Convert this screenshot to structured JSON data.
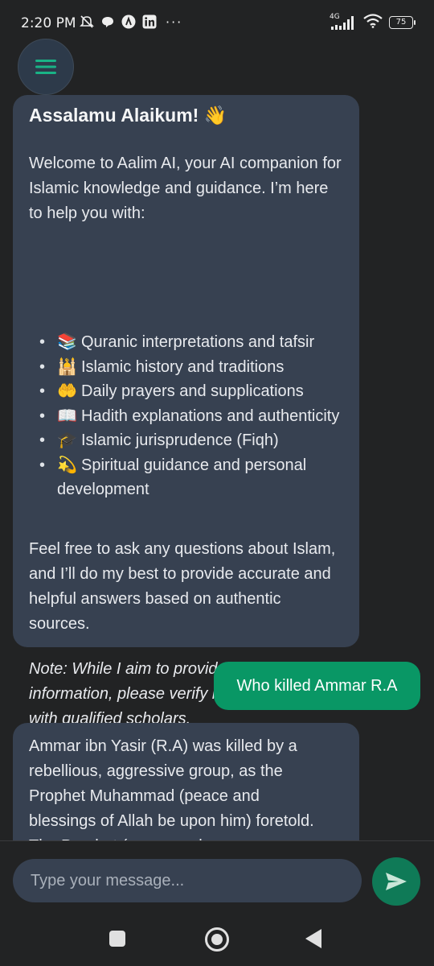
{
  "status_bar": {
    "time": "2:20 PM",
    "network": "4G",
    "battery": "75",
    "more": "···",
    "icons": [
      "mute-icon",
      "chat-bubble-icon",
      "app-a-icon",
      "linkedin-icon",
      "signal-icon",
      "wifi-icon",
      "battery-icon"
    ]
  },
  "menu": {
    "icon": "hamburger-menu-icon"
  },
  "welcome": {
    "title": "Assalamu Alaikum! 👋",
    "intro": "Welcome to Aalim AI, your AI companion for Islamic knowledge and guidance. I’m here to help you with:",
    "items": [
      {
        "emoji": "📚",
        "text": "Quranic interpretations and tafsir"
      },
      {
        "emoji": "🕌",
        "text": "Islamic history and traditions"
      },
      {
        "emoji": "🤲",
        "text": "Daily prayers and supplications"
      },
      {
        "emoji": "📖",
        "text": "Hadith explanations and authenticity"
      },
      {
        "emoji": "🎓",
        "text": "Islamic jurisprudence (Fiqh)"
      },
      {
        "emoji": "💫",
        "text": "Spiritual guidance and personal development"
      }
    ],
    "closing": "Feel free to ask any questions about Islam, and I’ll do my best to provide accurate and helpful answers based on authentic sources.",
    "note": "Note: While I aim to provide accurate information, please verify important matters with qualified scholars."
  },
  "user_message": "Who killed Ammar R.A",
  "bot_reply": "Ammar ibn Yasir (R.A) was killed by a rebellious, aggressive group, as the Prophet Muhammad (peace and blessings of Allah be upon him) foretold. The Prophet (peace and",
  "composer": {
    "placeholder": "Type your message...",
    "send_icon": "send-icon"
  },
  "colors": {
    "background": "#222324",
    "bot_bubble": "#374151",
    "user_bubble": "#099765",
    "accent": "#16a37f"
  }
}
